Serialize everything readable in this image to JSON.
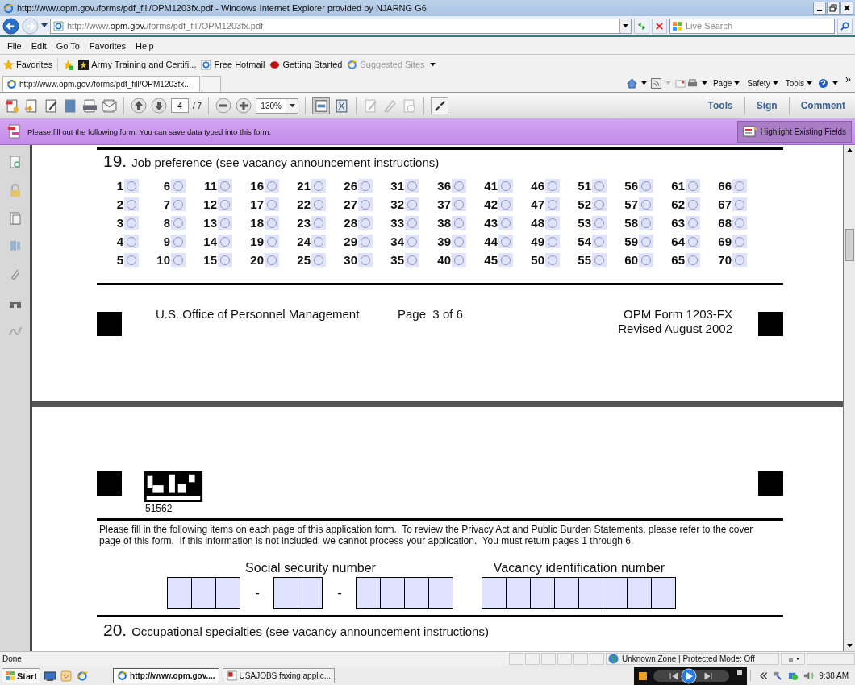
{
  "window": {
    "title": "http://www.opm.gov./forms/pdf_fill/OPM1203fx.pdf - Windows Internet Explorer provided by NJARNG G6"
  },
  "address_bar": {
    "url": "http://www.**opm.gov.**/forms/pdf_fill/OPM1203fx.pdf"
  },
  "search": {
    "placeholder": "Live Search"
  },
  "menu": [
    "File",
    "Edit",
    "Go To",
    "Favorites",
    "Help"
  ],
  "favorites_bar": {
    "label": "Favorites",
    "items": [
      {
        "label": "Army Training and Certifi...",
        "kind": "army",
        "disabled": false
      },
      {
        "label": "Free Hotmail",
        "kind": "page",
        "disabled": false
      },
      {
        "label": "Getting Started",
        "kind": "bird",
        "disabled": false
      },
      {
        "label": "Suggested Sites",
        "kind": "suggested",
        "disabled": true
      }
    ]
  },
  "tabs": [
    {
      "label": "http://www.opm.gov./forms/pdf_fill/OPM1203fx...",
      "selected": true
    }
  ],
  "command_bar": [
    "Page",
    "Safety",
    "Tools"
  ],
  "pdf_toolbar": {
    "page": "4",
    "page_total": "/ 7",
    "zoom": "130%",
    "panes": [
      "Tools",
      "Sign",
      "Comment"
    ]
  },
  "form_bar": {
    "message": "Please fill out the following form. You can save data typed into this form.",
    "button": "Highlight Existing Fields"
  },
  "page_1": {
    "section": {
      "number": "19.",
      "title": "Job preference (see vacancy announcement instructions)",
      "options": [
        {
          "label": "1",
          "checked": false
        },
        {
          "label": "2",
          "checked": false
        },
        {
          "label": "3",
          "checked": false
        },
        {
          "label": "4",
          "checked": false
        },
        {
          "label": "5",
          "checked": false
        },
        {
          "label": "6",
          "checked": false
        },
        {
          "label": "7",
          "checked": false
        },
        {
          "label": "8",
          "checked": false
        },
        {
          "label": "9",
          "checked": false
        },
        {
          "label": "10",
          "checked": false
        },
        {
          "label": "11",
          "checked": false
        },
        {
          "label": "12",
          "checked": false
        },
        {
          "label": "13",
          "checked": false
        },
        {
          "label": "14",
          "checked": false
        },
        {
          "label": "15",
          "checked": false
        },
        {
          "label": "16",
          "checked": false
        },
        {
          "label": "17",
          "checked": false
        },
        {
          "label": "18",
          "checked": false
        },
        {
          "label": "19",
          "checked": false
        },
        {
          "label": "20",
          "checked": false
        },
        {
          "label": "21",
          "checked": false
        },
        {
          "label": "22",
          "checked": false
        },
        {
          "label": "23",
          "checked": false
        },
        {
          "label": "24",
          "checked": false
        },
        {
          "label": "25",
          "checked": false
        },
        {
          "label": "26",
          "checked": false
        },
        {
          "label": "27",
          "checked": false
        },
        {
          "label": "28",
          "checked": false
        },
        {
          "label": "29",
          "checked": false
        },
        {
          "label": "30",
          "checked": false
        },
        {
          "label": "31",
          "checked": false
        },
        {
          "label": "32",
          "checked": false
        },
        {
          "label": "33",
          "checked": false
        },
        {
          "label": "34",
          "checked": false
        },
        {
          "label": "35",
          "checked": false
        },
        {
          "label": "36",
          "checked": false
        },
        {
          "label": "37",
          "checked": false
        },
        {
          "label": "38",
          "checked": false
        },
        {
          "label": "39",
          "checked": false
        },
        {
          "label": "40",
          "checked": false
        },
        {
          "label": "41",
          "checked": false
        },
        {
          "label": "42",
          "checked": false
        },
        {
          "label": "43",
          "checked": false
        },
        {
          "label": "44",
          "checked": false
        },
        {
          "label": "45",
          "checked": false
        },
        {
          "label": "46",
          "checked": false
        },
        {
          "label": "47",
          "checked": false
        },
        {
          "label": "48",
          "checked": false
        },
        {
          "label": "49",
          "checked": false
        },
        {
          "label": "50",
          "checked": false
        },
        {
          "label": "51",
          "checked": false
        },
        {
          "label": "52",
          "checked": false
        },
        {
          "label": "53",
          "checked": false
        },
        {
          "label": "54",
          "checked": false
        },
        {
          "label": "55",
          "checked": false
        },
        {
          "label": "56",
          "checked": false
        },
        {
          "label": "57",
          "checked": false
        },
        {
          "label": "58",
          "checked": false
        },
        {
          "label": "59",
          "checked": false
        },
        {
          "label": "60",
          "checked": false
        },
        {
          "label": "61",
          "checked": false
        },
        {
          "label": "62",
          "checked": false
        },
        {
          "label": "63",
          "checked": false
        },
        {
          "label": "64",
          "checked": false
        },
        {
          "label": "65",
          "checked": false
        },
        {
          "label": "66",
          "checked": false
        },
        {
          "label": "67",
          "checked": false
        },
        {
          "label": "68",
          "checked": false
        },
        {
          "label": "69",
          "checked": false
        },
        {
          "label": "70",
          "checked": false
        }
      ]
    },
    "footer": {
      "agency": "U.S. Office of Personnel Management",
      "page": "Page  3 of 6",
      "form": "OPM Form 1203-FX",
      "revised": "Revised August 2002"
    }
  },
  "page_2": {
    "barcode_number": "51562",
    "instructions": "Please fill in the following items on each page of this application form.  To review the Privacy Act and Public Burden Statements, please refer to the cover page of this form.  If this information is not included, we cannot process your application.  You must return pages 1 through 6.",
    "ssn": {
      "label": "Social security number",
      "separators": [
        "-",
        "-"
      ]
    },
    "vacancy": {
      "label": "Vacancy identification number"
    },
    "section": {
      "number": "20.",
      "title": "Occupational specialties (see vacancy announcement instructions)"
    }
  },
  "status_bar": {
    "text": "Done",
    "zone": "Unknown Zone | Protected Mode: Off"
  },
  "taskbar": {
    "start": "Start",
    "tasks": [
      {
        "label": "http://www.opm.gov....",
        "kind": "ie",
        "selected": true
      },
      {
        "label": "USAJOBS faxing applic...",
        "kind": "pdf",
        "selected": false
      }
    ],
    "time": "9:38 AM"
  }
}
